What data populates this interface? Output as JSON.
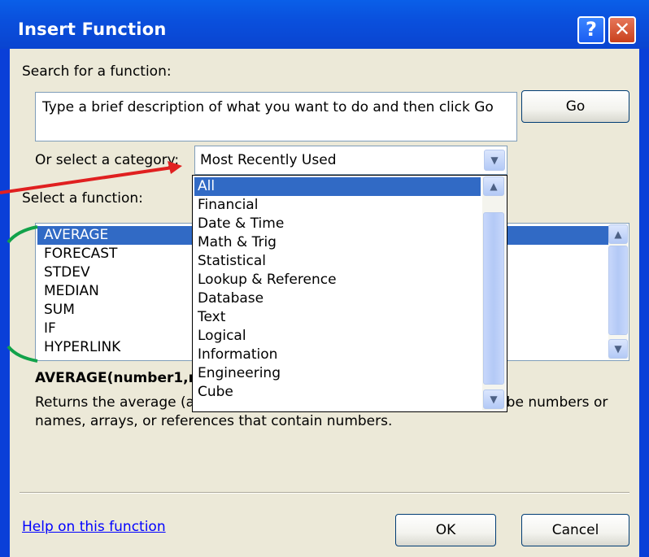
{
  "title": "Insert Function",
  "titlebar": {
    "help_glyph": "?",
    "close_glyph": "✕"
  },
  "search": {
    "label": "Search for a function:",
    "value": "Type a brief description of what you want to do and then click Go",
    "go_label": "Go"
  },
  "category": {
    "label": "Or select a category:",
    "selected": "Most Recently Used",
    "options": [
      "All",
      "Financial",
      "Date & Time",
      "Math & Trig",
      "Statistical",
      "Lookup & Reference",
      "Database",
      "Text",
      "Logical",
      "Information",
      "Engineering",
      "Cube"
    ],
    "highlighted": "All"
  },
  "functions": {
    "label": "Select a function:",
    "items": [
      "AVERAGE",
      "FORECAST",
      "STDEV",
      "MEDIAN",
      "SUM",
      "IF",
      "HYPERLINK"
    ],
    "selected": "AVERAGE"
  },
  "signature": "AVERAGE(number1,number2,...)",
  "description": "Returns the average (arithmetic mean) of its arguments, which can be numbers or names, arrays, or references that contain numbers.",
  "help_link": "Help on this function",
  "buttons": {
    "ok": "OK",
    "cancel": "Cancel"
  },
  "colors": {
    "selection": "#316ac5",
    "annotation_red": "#e02020",
    "annotation_green": "#12a24a"
  }
}
